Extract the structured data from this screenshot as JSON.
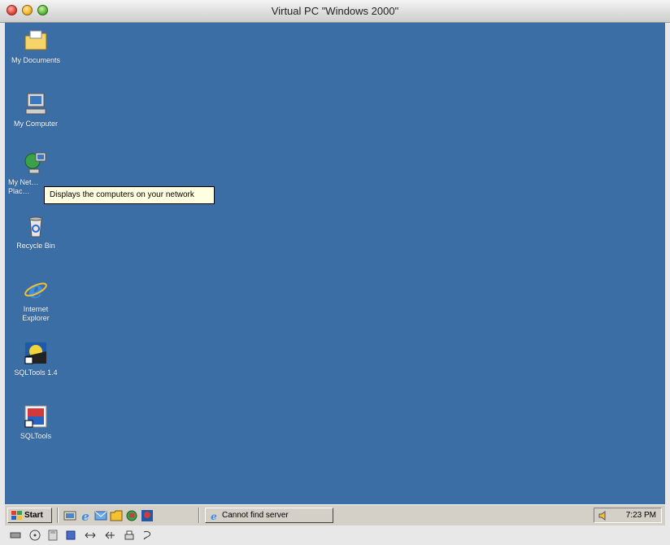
{
  "window": {
    "title": "Virtual PC \"Windows 2000\""
  },
  "desktop": {
    "background": "#3a6ea5",
    "icons": [
      {
        "label": "My Documents"
      },
      {
        "label": "My Computer"
      },
      {
        "label": "My Net… Plac…"
      },
      {
        "label": "Recycle Bin"
      },
      {
        "label": "Internet Explorer"
      },
      {
        "label": "SQLTools 1.4"
      },
      {
        "label": "SQLTools"
      }
    ],
    "tooltip": "Displays the computers on your network"
  },
  "taskbar": {
    "start_label": "Start",
    "quick_launch": [
      "desktop-icon",
      "ie-icon",
      "outlook-icon",
      "folder-icon",
      "network-icon",
      "sqltools-icon"
    ],
    "task_label": "Cannot find server",
    "clock": "7:23 PM"
  },
  "statusbar": {
    "icons": [
      "drive-icon",
      "cd-icon",
      "floppy-icon",
      "network-adapter-icon",
      "shared-folder-icon",
      "arrow-icon",
      "printer-icon",
      "sound-icon"
    ]
  }
}
